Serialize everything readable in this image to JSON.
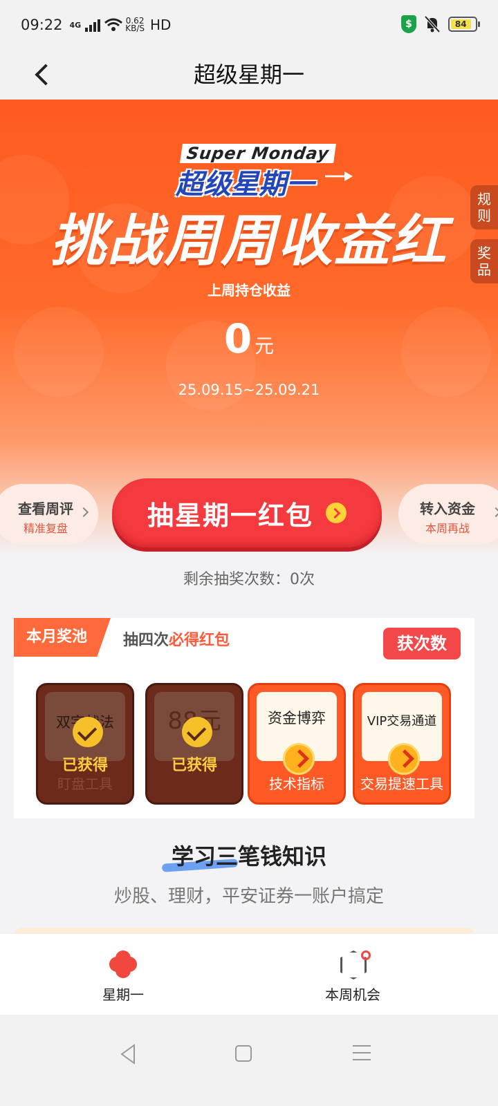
{
  "status": {
    "time": "09:22",
    "network": "4G",
    "speed_value": "0.62",
    "speed_unit": "KB/S",
    "hd": "HD",
    "battery": "84",
    "shield_symbol": "$"
  },
  "nav": {
    "title": "超级星期一"
  },
  "hero": {
    "brand_en": "Super Monday",
    "brand_cn": "超级星期一",
    "headline": "挑战周周收益红",
    "subtitle": "上周持仓收益",
    "amount": "0",
    "unit": "元",
    "dates": "25.09.15~25.09.21",
    "side_tabs": [
      {
        "label": "规\n则"
      },
      {
        "label": "奖\n品"
      }
    ]
  },
  "actions": {
    "left": {
      "title": "查看周评",
      "sub": "精准复盘"
    },
    "main": {
      "label": "抽星期一红包"
    },
    "right": {
      "title": "转入资金",
      "sub": "本周再战"
    }
  },
  "remaining": "剩余抽奖次数：0次",
  "pool": {
    "tag": "本月奖池",
    "desc_prefix": "抽四次",
    "desc_highlight": "必得红包",
    "button": "获次数",
    "prizes": [
      {
        "title": "双字战法",
        "bottom": "盯盘工具",
        "status": "已获得",
        "obtained": true
      },
      {
        "title": "88元",
        "bottom": "",
        "status": "已获得",
        "obtained": true
      },
      {
        "title": "资金博弈",
        "bottom": "技术指标",
        "status": "",
        "obtained": false
      },
      {
        "title": "VIP交易通道",
        "bottom": "交易提速工具",
        "status": "",
        "obtained": false
      }
    ]
  },
  "learn": {
    "title": "学习三笔钱知识",
    "subtitle": "炒股、理财，平安证券一账户搞定"
  },
  "tabs": [
    {
      "label": "星期一",
      "icon": "flower-icon",
      "active": true
    },
    {
      "label": "本周机会",
      "icon": "hexagon-target-icon",
      "active": false
    }
  ],
  "colors": {
    "accent": "#ff5a1f",
    "button_red": "#f43a3e",
    "highlight": "#ff5a3a"
  }
}
